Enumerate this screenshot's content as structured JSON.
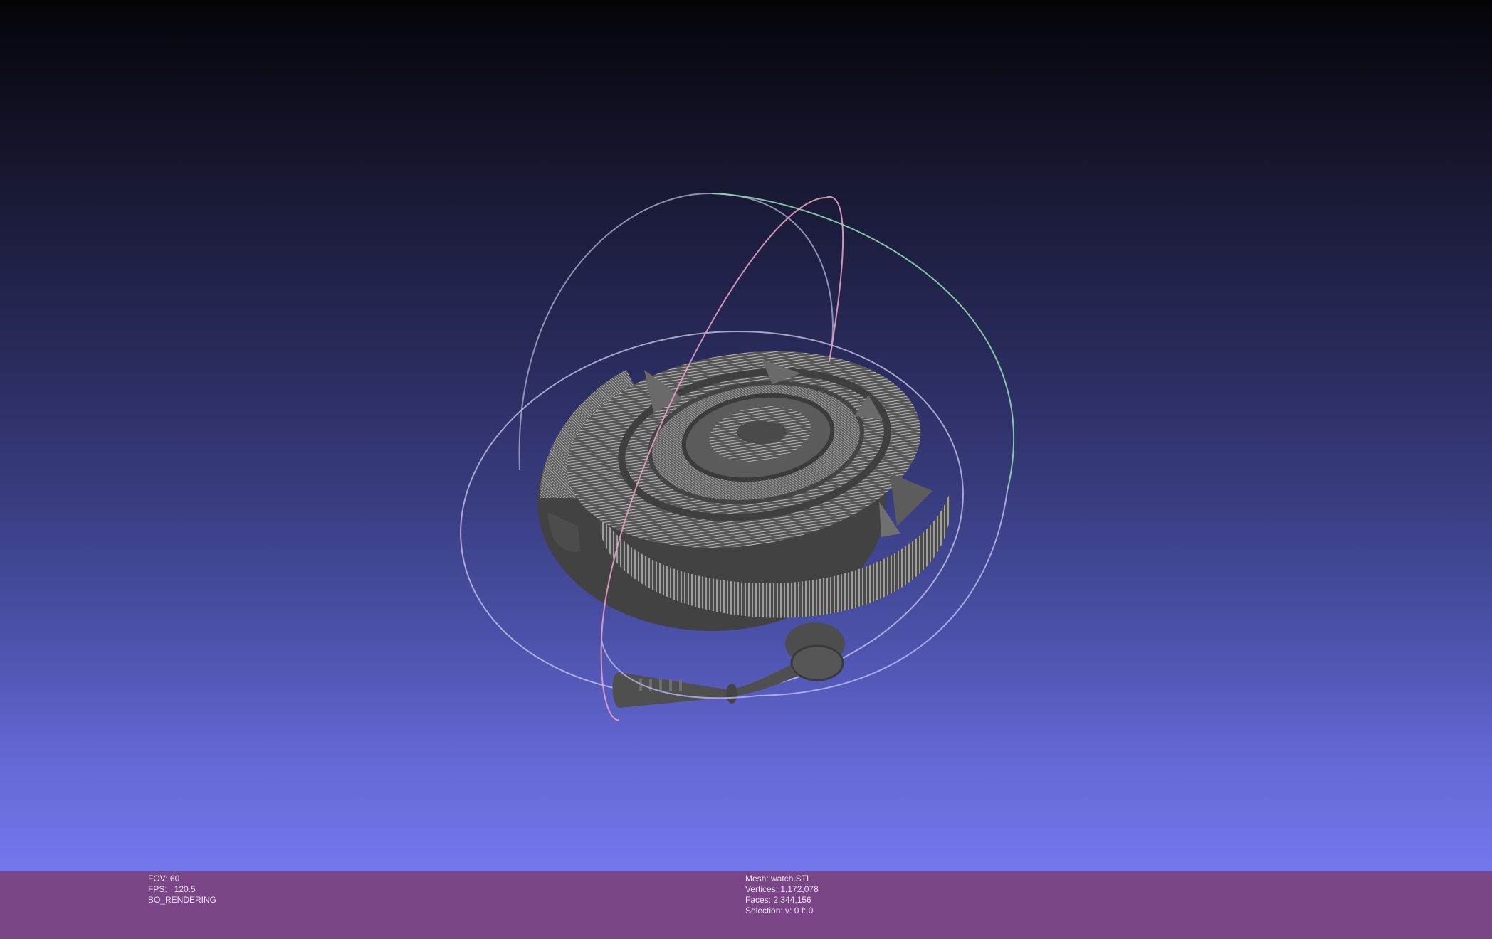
{
  "viewer": {
    "stats_left": {
      "fov": "FOV: 60",
      "fps": "FPS:   120.5",
      "mode": "BO_RENDERING"
    },
    "stats_right": {
      "mesh": "Mesh: watch.STL",
      "vertices": "Vertices: 1,172,078",
      "faces": "Faces: 2,344,156",
      "selection": "Selection: v: 0 f: 0"
    }
  },
  "colors": {
    "background_top": "#040408",
    "background_bottom": "#7377ec",
    "info_bar": "#7b4688",
    "info_text": "#e8e4ee",
    "mesh": "#5a5a5a",
    "mesh_highlight": "#d4d4d4",
    "trackball_green": "#8fd6b0",
    "trackball_pink": "#e6a0c0",
    "trackball_blue": "#b8b8f0"
  },
  "icons": {
    "trackball": "trackball-gizmo-icon",
    "model": "watch-mesh-model"
  }
}
